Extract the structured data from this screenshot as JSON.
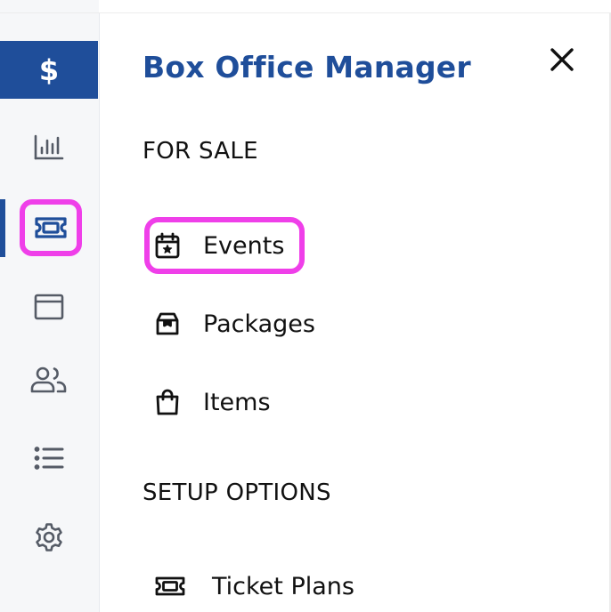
{
  "rail": {
    "brand_label": "$",
    "items": [
      {
        "name": "reports",
        "icon": "bar-chart-icon"
      },
      {
        "name": "box-office",
        "icon": "ticket-icon",
        "active": true
      },
      {
        "name": "website",
        "icon": "browser-window-icon"
      },
      {
        "name": "customers",
        "icon": "users-icon"
      },
      {
        "name": "lists",
        "icon": "list-icon"
      },
      {
        "name": "settings",
        "icon": "gear-icon"
      }
    ]
  },
  "panel": {
    "title": "Box Office Manager",
    "close_icon": "close-icon",
    "sections": [
      {
        "heading": "FOR SALE",
        "items": [
          {
            "label": "Events",
            "icon": "calendar-star-icon",
            "highlighted": true
          },
          {
            "label": "Packages",
            "icon": "package-icon"
          },
          {
            "label": "Items",
            "icon": "shopping-bag-icon"
          }
        ]
      },
      {
        "heading": "SETUP OPTIONS",
        "items": [
          {
            "label": "Ticket Plans",
            "icon": "ticket-icon"
          }
        ]
      }
    ]
  },
  "colors": {
    "brand": "#1f4e9a",
    "highlight": "#ef3fe9",
    "rail_bg": "#f6f7f9",
    "text": "#111111"
  }
}
